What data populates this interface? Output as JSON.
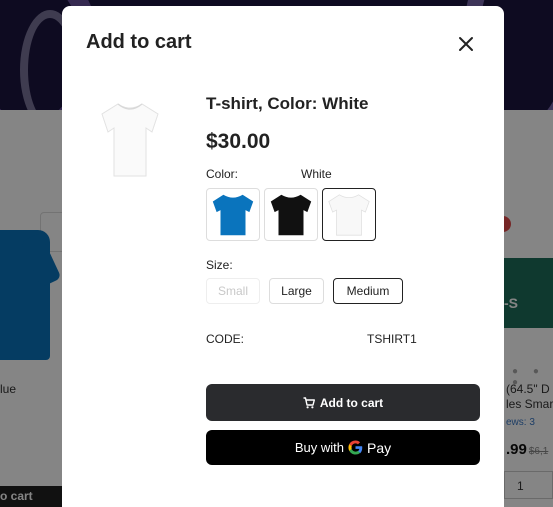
{
  "background": {
    "left_text": "lue",
    "left_bar": "o cart",
    "tv_label": "-S",
    "right_lines": [
      "(64.5\" D",
      "les Smar",
      "ews: 3"
    ],
    "right_price": ".99",
    "right_old_price": "$6,1",
    "qty": "1"
  },
  "modal": {
    "title": "Add to cart",
    "close_icon": "close-icon"
  },
  "product": {
    "name": "T-shirt, Color: White",
    "price": "$30.00",
    "image_icon": "white-tshirt-image"
  },
  "color": {
    "label": "Color:",
    "selected": "White",
    "options": [
      {
        "name": "Blue",
        "hex": "#0a74bd"
      },
      {
        "name": "Black",
        "hex": "#111111"
      },
      {
        "name": "White",
        "hex": "#f4f4f4"
      }
    ]
  },
  "size": {
    "label": "Size:",
    "options": [
      "Small",
      "Large",
      "Medium"
    ],
    "selected": "Medium",
    "disabled": [
      "Small"
    ]
  },
  "code": {
    "label": "CODE:",
    "value": "TSHIRT1"
  },
  "actions": {
    "add_to_cart": "Add to cart",
    "buy_with": "Buy with",
    "pay": "Pay"
  },
  "colors": {
    "primary_button": "#2a2b2e",
    "gpay_button": "#000000"
  }
}
